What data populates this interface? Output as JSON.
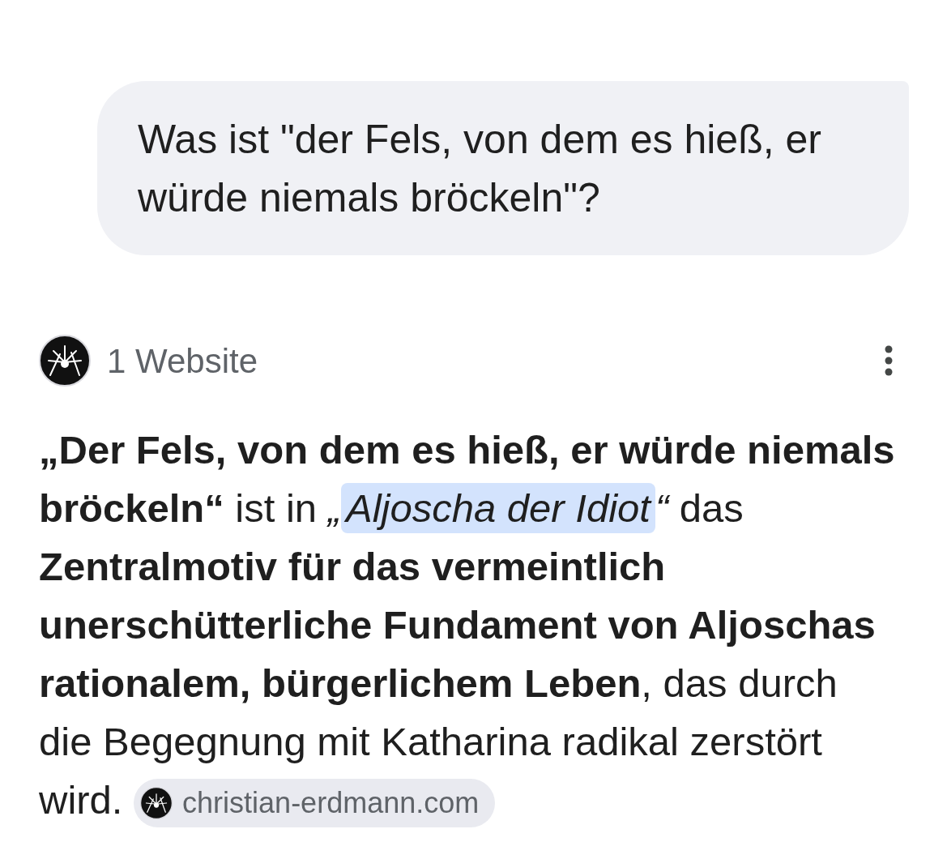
{
  "user_message": {
    "text": "Was ist \"der Fels, von dem es hieß, er würde niemals bröckeln\"?"
  },
  "sources_header": {
    "label": "1 Website"
  },
  "answer": {
    "parts": [
      {
        "kind": "text",
        "text": "**„Der Fels, von dem es hieß, er würde niemals bröckeln“** ist in *„*"
      },
      {
        "kind": "highlight",
        "text": "Aljoscha der Idiot"
      },
      {
        "kind": "text",
        "text": "*“* das **Zentralmotiv für das vermeintlich unerschütterliche Fundament von Aljoschas rationalem, bürgerlichem Leben**, das durch die Begegnung mit Katharina radikal zerstört wird. "
      },
      {
        "kind": "source_chip",
        "text": "christian-erdmann.com"
      }
    ]
  }
}
